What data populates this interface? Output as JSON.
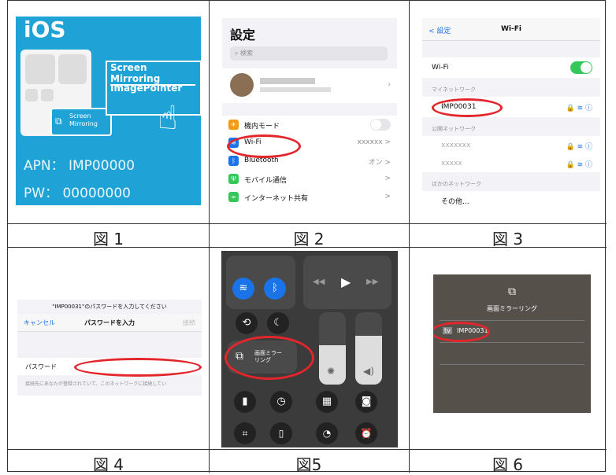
{
  "captions": [
    "図 1",
    "図 2",
    "図 3",
    "図 4",
    "図5",
    "図 6"
  ],
  "panel1": {
    "title": "iOS",
    "screen_mirroring_label": "Screen Mirroring",
    "app_label": "ImagePointer",
    "tile_label": "Screen Mirroring",
    "apn": "APN： IMP00000",
    "pw": "PW： 00000000",
    "accent": "#1fa3d6"
  },
  "panel2": {
    "title": "設定",
    "search_placeholder": "検索",
    "rows": [
      {
        "label": "機内モード",
        "value": "",
        "icon": "airplane-icon",
        "color": "#f39c12"
      },
      {
        "label": "Wi-Fi",
        "value": "xxxxxx >",
        "icon": "wifi-icon",
        "color": "#1a73e8"
      },
      {
        "label": "Bluetooth",
        "value": "オン >",
        "icon": "bluetooth-icon",
        "color": "#1a73e8"
      },
      {
        "label": "モバイル通信",
        "value": ">",
        "icon": "antenna-icon",
        "color": "#34c759"
      },
      {
        "label": "インターネット共有",
        "value": ">",
        "icon": "link-icon",
        "color": "#34c759"
      }
    ]
  },
  "panel3": {
    "back": "< 設定",
    "title": "Wi-Fi",
    "wifi_label": "Wi-Fi",
    "my_networks": "マイネットワーク",
    "network": "IMP00031",
    "public_networks": "公開ネットワーク",
    "other_networks": "ほかのネットワーク",
    "other": "その他...",
    "public_items": [
      "xxxxxxx",
      "xxxxx"
    ]
  },
  "panel4": {
    "prompt": "\"IMP00031\"のパスワードを入力してください",
    "cancel": "キャンセル",
    "header": "パスワードを入力",
    "join": "接続",
    "password_label": "パスワード",
    "footer": "接続先にあなたが登録されていて、このネットワークに接続してい"
  },
  "panel5": {
    "mirroring_label": "画面ミラー\nリング"
  },
  "panel6": {
    "title": "画面ミラーリング",
    "device": "IMP00031"
  }
}
